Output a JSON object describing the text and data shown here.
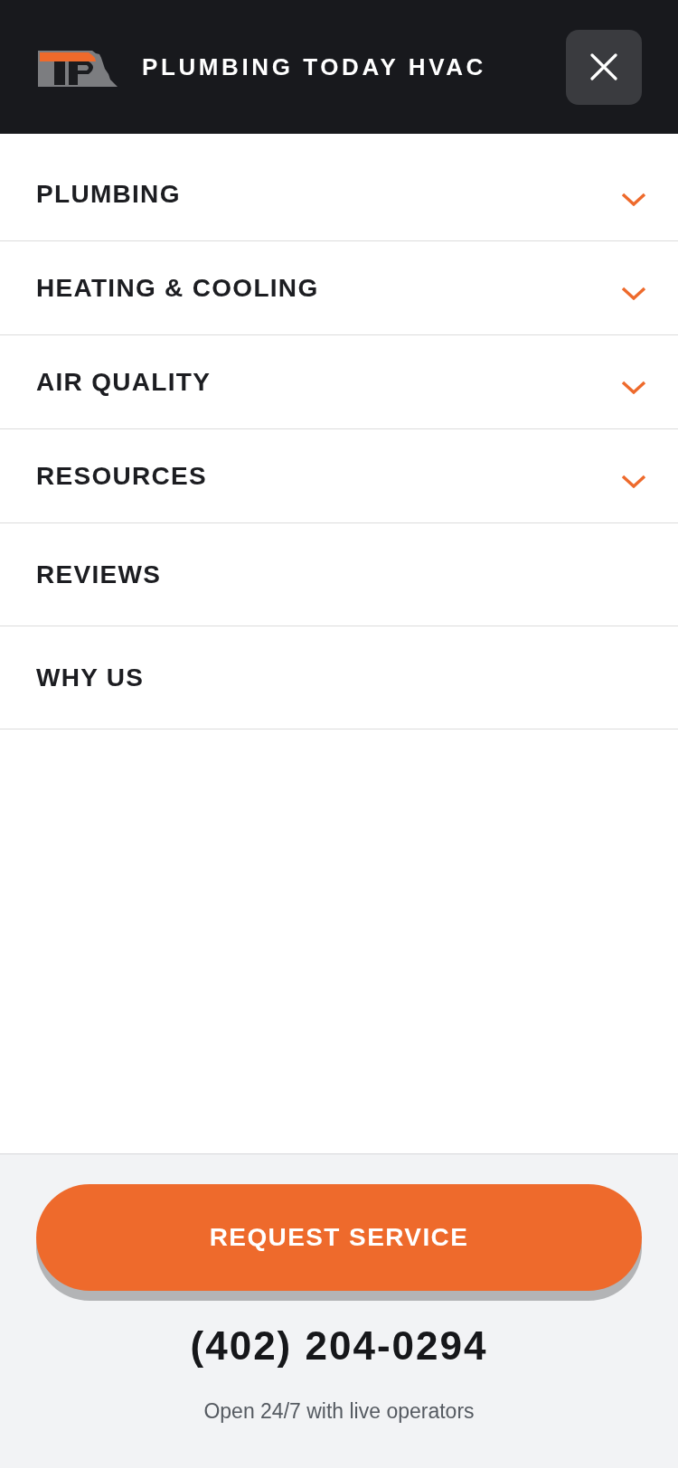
{
  "header": {
    "brand": "PLUMBING TODAY HVAC"
  },
  "menu": [
    {
      "label": "PLUMBING",
      "kind": "dropdown"
    },
    {
      "label": "HEATING & COOLING",
      "kind": "dropdown"
    },
    {
      "label": "AIR QUALITY",
      "kind": "dropdown"
    },
    {
      "label": "RESOURCES",
      "kind": "dropdown"
    },
    {
      "label": "REVIEWS",
      "kind": "link"
    },
    {
      "label": "WHY US",
      "kind": "link"
    }
  ],
  "footer": {
    "button": "REQUEST SERVICE",
    "phone": "(402) 204-0294",
    "note": "Open 24/7 with live operators"
  }
}
